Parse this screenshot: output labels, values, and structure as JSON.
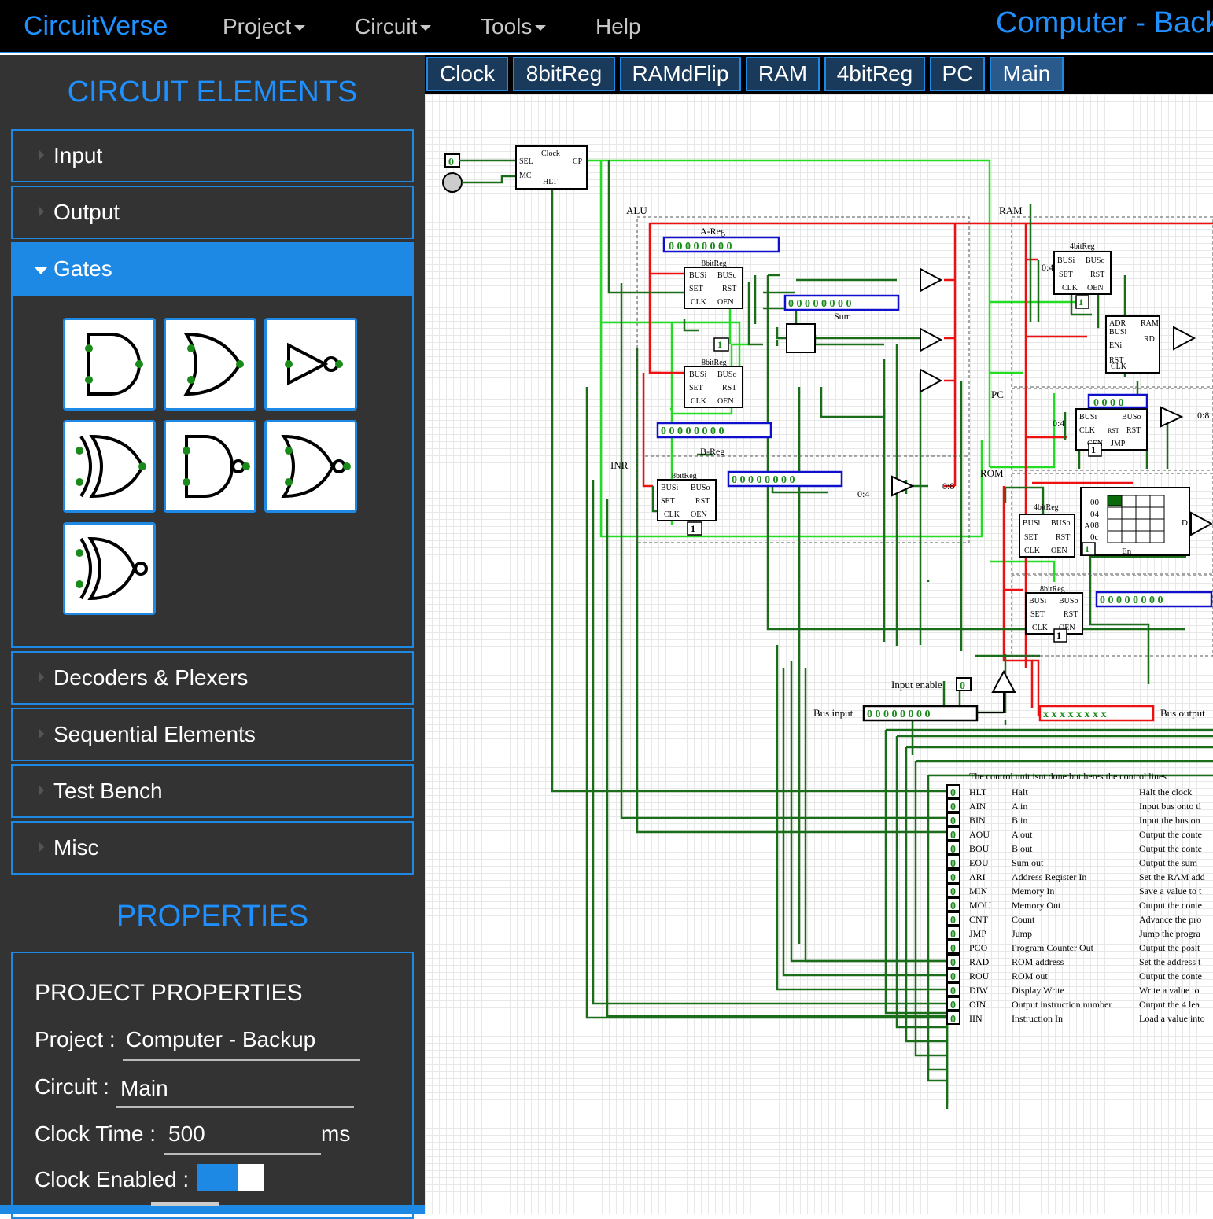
{
  "navbar": {
    "brand": "CircuitVerse",
    "menus": [
      "Project",
      "Circuit",
      "Tools",
      "Help"
    ],
    "project_title": "Computer - Backup"
  },
  "sidebar": {
    "elements_heading": "CIRCUIT ELEMENTS",
    "categories": [
      "Input",
      "Output",
      "Gates",
      "Decoders & Plexers",
      "Sequential Elements",
      "Test Bench",
      "Misc"
    ],
    "expanded_category": "Gates",
    "gates": [
      "and-gate-icon",
      "or-gate-icon",
      "not-gate-icon",
      "xor-gate-icon",
      "nand-gate-icon",
      "nor-gate-icon",
      "xnor-gate-icon"
    ],
    "properties_heading": "PROPERTIES",
    "project_properties": {
      "heading": "PROJECT PROPERTIES",
      "project_label": "Project :",
      "project_value": "Computer - Backup",
      "circuit_label": "Circuit :",
      "circuit_value": "Main",
      "clock_time_label": "Clock Time :",
      "clock_time_value": "500",
      "clock_time_unit": "ms",
      "clock_enabled_label": "Clock Enabled :",
      "clock_enabled": true
    }
  },
  "tabs": [
    "Clock",
    "8bitReg",
    "RAMdFlip",
    "RAM",
    "4bitReg",
    "PC",
    "Main"
  ],
  "active_tab": "Main",
  "canvas": {
    "section_labels": {
      "alu": "ALU",
      "ram": "RAM",
      "pc": "PC",
      "inr": "INR",
      "rom": "ROM"
    },
    "clock_block": {
      "title": "Clock",
      "pins": [
        "SEL",
        "MC",
        "HLT",
        "CP"
      ]
    },
    "register_labels": {
      "a_reg": "A-Reg",
      "b_reg": "B-Reg",
      "sum": "Sum"
    },
    "reg_8bit_title": "8bitReg",
    "reg_4bit_title": "4bitReg",
    "reg_pins": [
      "BUSi",
      "BUSo",
      "SET",
      "RST",
      "CLK",
      "OEN"
    ],
    "byte_zero": "0 0 0 0 0 0 0 0",
    "nibble_zero": "0 0 0 0",
    "bus_output_value": "x x x x x x x x",
    "splitter_labels": {
      "s04": "0:4",
      "s08": "0:8"
    },
    "ram_block": {
      "title": "RAM",
      "pins": [
        "ADR",
        "BUSi",
        "ENi",
        "RST",
        "CLK",
        "RD"
      ]
    },
    "pc_block": {
      "title": "PC",
      "pins": [
        "BUSi",
        "BUSo",
        "CLK",
        "RST",
        "CEN",
        "JMP"
      ]
    },
    "rom_block": {
      "rows": [
        "00",
        "04",
        "08",
        "0c"
      ],
      "cell": "00",
      "left_pin": "A",
      "right_pin": "D",
      "bottom_pin": "En"
    },
    "const_one": "1",
    "input_zero": "0",
    "io_labels": {
      "input_enable": "Input enable",
      "bus_input": "Bus input",
      "bus_output": "Bus output"
    },
    "control_note": "The control unit isnt done but heres the control lines",
    "control_lines": [
      {
        "code": "HLT",
        "name": "Halt",
        "desc": "Halt the clock"
      },
      {
        "code": "AIN",
        "name": "A in",
        "desc": "Input bus onto tl"
      },
      {
        "code": "BIN",
        "name": "B in",
        "desc": "Input the bus on"
      },
      {
        "code": "AOU",
        "name": "A out",
        "desc": "Output the conte"
      },
      {
        "code": "BOU",
        "name": "B out",
        "desc": "Output the conte"
      },
      {
        "code": "EOU",
        "name": "Sum out",
        "desc": "Output the sum"
      },
      {
        "code": "ARI",
        "name": "Address Register In",
        "desc": "Set the RAM add"
      },
      {
        "code": "MIN",
        "name": "Memory In",
        "desc": "Save a value to t"
      },
      {
        "code": "MOU",
        "name": "Memory Out",
        "desc": "Output the conte"
      },
      {
        "code": "CNT",
        "name": "Count",
        "desc": "Advance the pro"
      },
      {
        "code": "JMP",
        "name": "Jump",
        "desc": "Jump the progra"
      },
      {
        "code": "PCO",
        "name": "Program Counter Out",
        "desc": "Output the posit"
      },
      {
        "code": "RAD",
        "name": "ROM address",
        "desc": "Set the address t"
      },
      {
        "code": "ROU",
        "name": "ROM out",
        "desc": "Output the conte"
      },
      {
        "code": "DIW",
        "name": "Display Write",
        "desc": "Write a value to"
      },
      {
        "code": "OIN",
        "name": "Output instruction number",
        "desc": "Output the 4 lea"
      },
      {
        "code": "IIN",
        "name": "Instruction In",
        "desc": "Load a value into"
      }
    ]
  },
  "colors": {
    "accent": "#1e88e5",
    "wire_low": "#1a6e1a",
    "wire_high": "#22dd22",
    "wire_bus": "#ee1111",
    "display_border": "#1010cc"
  }
}
